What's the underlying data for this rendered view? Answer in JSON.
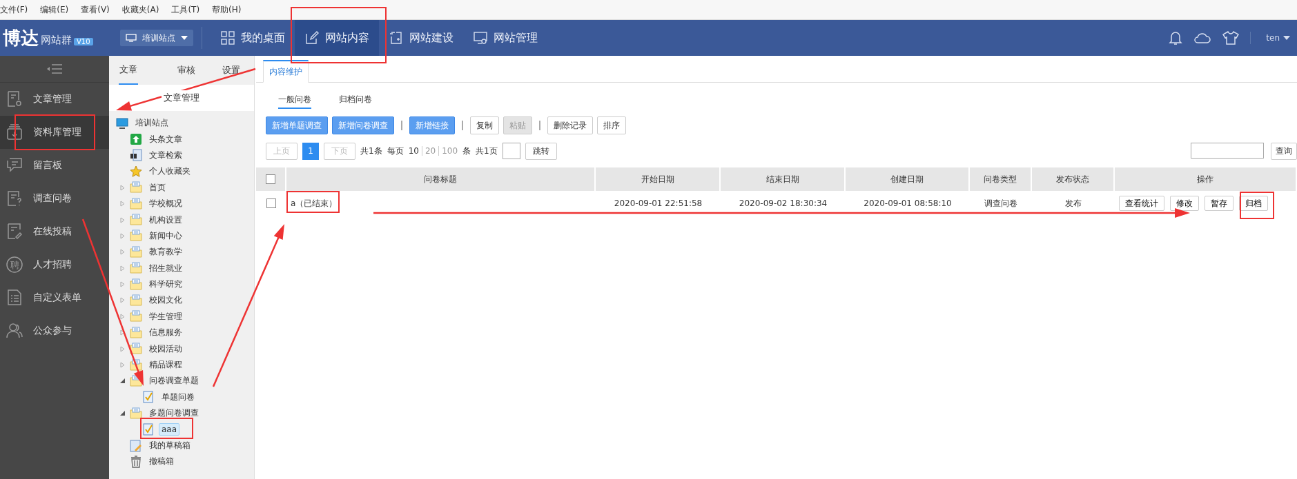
{
  "menu_bar": [
    "文件(F)",
    "编辑(E)",
    "查看(V)",
    "收藏夹(A)",
    "工具(T)",
    "帮助(H)"
  ],
  "header": {
    "logo": "博达",
    "product": "网站群",
    "version": "V10",
    "site_selector": "培训站点",
    "nav": [
      {
        "label": "我的桌面",
        "selected": false
      },
      {
        "label": "网站内容",
        "selected": true
      },
      {
        "label": "网站建设",
        "selected": false
      },
      {
        "label": "网站管理",
        "selected": false
      }
    ],
    "user": "ten"
  },
  "sidebar": {
    "items": [
      {
        "label": "文章管理",
        "selected": false
      },
      {
        "label": "资料库管理",
        "selected": true
      },
      {
        "label": "留言板",
        "selected": false
      },
      {
        "label": "调查问卷",
        "selected": false
      },
      {
        "label": "在线投稿",
        "selected": false
      },
      {
        "label": "人才招聘",
        "selected": false
      },
      {
        "label": "自定义表单",
        "selected": false
      },
      {
        "label": "公众参与",
        "selected": false
      }
    ],
    "hire_glyph": "聘"
  },
  "tree_panel": {
    "tabs": [
      {
        "label": "文章",
        "selected": true
      },
      {
        "label": "审核",
        "selected": false
      },
      {
        "label": "设置",
        "selected": false
      }
    ],
    "title": "文章管理",
    "tree": [
      {
        "label": "培训站点",
        "kind": "monitor",
        "selected": false,
        "children": [
          {
            "label": "头条文章",
            "kind": "up",
            "selected": false
          },
          {
            "label": "文章检索",
            "kind": "search-doc",
            "selected": false
          },
          {
            "label": "个人收藏夹",
            "kind": "star",
            "selected": false
          },
          {
            "label": "首页",
            "kind": "folder",
            "expanded": false,
            "selected": false
          },
          {
            "label": "学校概况",
            "kind": "folder",
            "expanded": false,
            "selected": false
          },
          {
            "label": "机构设置",
            "kind": "folder",
            "expanded": false,
            "selected": false
          },
          {
            "label": "新闻中心",
            "kind": "folder",
            "expanded": false,
            "selected": false
          },
          {
            "label": "教育教学",
            "kind": "folder",
            "expanded": false,
            "selected": false
          },
          {
            "label": "招生就业",
            "kind": "folder",
            "expanded": false,
            "selected": false
          },
          {
            "label": "科学研究",
            "kind": "folder",
            "expanded": false,
            "selected": false
          },
          {
            "label": "校园文化",
            "kind": "folder",
            "expanded": false,
            "selected": false
          },
          {
            "label": "学生管理",
            "kind": "folder",
            "expanded": false,
            "selected": false
          },
          {
            "label": "信息服务",
            "kind": "folder",
            "expanded": false,
            "selected": false
          },
          {
            "label": "校园活动",
            "kind": "folder",
            "expanded": false,
            "selected": false
          },
          {
            "label": "精品课程",
            "kind": "folder",
            "expanded": false,
            "selected": false
          },
          {
            "label": "问卷调查单题",
            "kind": "folder",
            "expanded": true,
            "selected": false,
            "children": [
              {
                "label": "单题问卷",
                "kind": "survey",
                "selected": false
              }
            ]
          },
          {
            "label": "多题问卷调查",
            "kind": "folder",
            "expanded": true,
            "selected": false,
            "children": [
              {
                "label": "aaa",
                "kind": "survey",
                "selected": true
              }
            ]
          },
          {
            "label": "我的草稿箱",
            "kind": "draft",
            "selected": false
          },
          {
            "label": "撤稿箱",
            "kind": "trash",
            "selected": false
          }
        ]
      }
    ]
  },
  "content": {
    "tabs": [
      {
        "label": "内容维护",
        "selected": true
      }
    ],
    "subtabs": [
      {
        "label": "一般问卷",
        "selected": true
      },
      {
        "label": "归档问卷",
        "selected": false
      }
    ],
    "toolbar": [
      {
        "label": "新增单题调查",
        "kind": "primary",
        "disabled": false
      },
      {
        "label": "新增问卷调查",
        "kind": "primary",
        "disabled": false
      },
      {
        "kind": "separator"
      },
      {
        "label": "新增链接",
        "kind": "primary",
        "disabled": false
      },
      {
        "kind": "separator"
      },
      {
        "label": "复制",
        "kind": "default",
        "disabled": false
      },
      {
        "label": "粘贴",
        "kind": "default",
        "disabled": true
      },
      {
        "kind": "separator"
      },
      {
        "label": "删除记录",
        "kind": "default",
        "disabled": false
      },
      {
        "label": "排序",
        "kind": "default",
        "disabled": false
      }
    ],
    "pager": {
      "prev": {
        "label": "上页",
        "disabled": true
      },
      "pages": [
        {
          "label": "1",
          "selected": true
        }
      ],
      "next": {
        "label": "下页",
        "disabled": true
      },
      "total": "共1条",
      "per_page_label": "每页",
      "page_sizes": [
        {
          "label": "10",
          "selected": true
        },
        {
          "label": "20",
          "selected": false
        },
        {
          "label": "100",
          "selected": false
        }
      ],
      "unit": "条",
      "page_count": "共1页",
      "jump": "跳转"
    },
    "search_button": "查询",
    "table": {
      "columns": [
        "问卷标题",
        "开始日期",
        "结束日期",
        "创建日期",
        "问卷类型",
        "发布状态",
        "操作"
      ],
      "header_checked": false,
      "rows": [
        {
          "checked": false,
          "title": "a（已结束）",
          "start": "2020-09-01 22:51:58",
          "end": "2020-09-02 18:30:34",
          "created": "2020-09-01 08:58:10",
          "type": "调查问卷",
          "status": "发布",
          "actions": [
            "查看统计",
            "修改",
            "暂存",
            "归档"
          ]
        }
      ]
    }
  }
}
